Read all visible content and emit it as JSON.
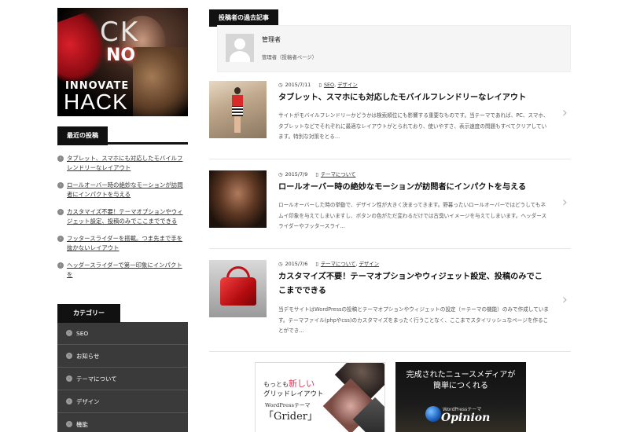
{
  "sidebar": {
    "hero_logo": {
      "letters": "CK",
      "no": "NO",
      "innovate": "INNOVATE",
      "hack": "HACK"
    },
    "recent_heading": "最近の投稿",
    "recent_posts": [
      "タブレット、スマホにも対応したモバイルフレンドリーなレイアウト",
      "ロールオーバー時の絶妙なモーションが訪問者にインパクトを与える",
      "カスタマイズ不要！テーマオプションやウィジェット設定、投稿のみでここまでできる",
      "フッタースライダーを搭載。つま先まで手を抜かないレイアウト",
      "ヘッダースライダーで第一印象にインパクトを"
    ],
    "category_heading": "カテゴリー",
    "categories": [
      "SEO",
      "お知らせ",
      "テーマについて",
      "デザイン",
      "機能"
    ]
  },
  "main": {
    "heading": "投稿者の過去記事",
    "author": {
      "name": "管理者",
      "role": "管理者（投稿者ページ）"
    },
    "posts": [
      {
        "date": "2015/7/11",
        "cat1": "SEO",
        "sep": ",",
        "cat2": "デザイン",
        "title": "タブレット、スマホにも対応したモバイルフレンドリーなレイアウト",
        "excerpt": "サイトがモバイルフレンドリーかどうかは検索順位にも影響する重要なものです。当テーマであれば、PC、スマホ、タブレットなどでそれぞれに最適なレイアウトがとられており、使いやすさ、表示速度の問題もすべてクリアしています。特別な対策をとる..."
      },
      {
        "date": "2015/7/9",
        "cat1": "テーマについて",
        "sep": "",
        "cat2": "",
        "title": "ロールオーバー時の絶妙なモーションが訪問者にインパクトを与える",
        "excerpt": "ロールオーバーした時の挙動で、デザイン性が大きく決まってきます。野暮ったいロールオーバーではどうしてもネムイ印象を与えてしまいますし、ボタンの色がただ変わるだけでは古臭いイメージを与えてしまいます。ヘッダースライダーやフッタースライ..."
      },
      {
        "date": "2015/7/6",
        "cat1": "テーマについて",
        "sep": ",",
        "cat2": "デザイン",
        "title": "カスタマイズ不要！テーマオプションやウィジェット設定、投稿のみでここまでできる",
        "excerpt": "当デモサイトはWordPressの投稿とテーマオプションやウィジェットの設定（＝テーマの機能）のみで作成しています。テーマファイル(phpやcss)のカスタマイズをまったく行うことなく、ここまでスタイリッシュなページを作ることができ..."
      }
    ],
    "banners": {
      "grider": {
        "line1a": "もっとも",
        "line1b": "新しい",
        "line2": "グリッドレイアウト",
        "line3": "WordPressテーマ",
        "line4": "「Grider」"
      },
      "opinion": {
        "line1": "完成されたニュースメディアが",
        "line2": "簡単につくれる",
        "line3": "WordPressテーマ",
        "line4": "Opinion"
      }
    }
  },
  "icons": {
    "clock": "clock-icon",
    "doc": "document-icon",
    "chevron": "chevron-right-icon",
    "bullet": "circle-arrow-icon"
  },
  "colors": {
    "dark": "#111111",
    "category_bg": "#3a3a3a",
    "accent_pink": "#e2335a"
  }
}
